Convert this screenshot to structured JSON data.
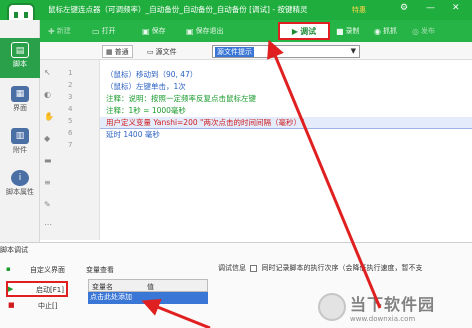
{
  "window": {
    "title": "鼠标左键连点器（可调频率）_自动备份_自动备份_自动备份 [调试] - 按键精灵",
    "vip_label": "特惠",
    "controls": [
      "⚙",
      "—",
      "✕"
    ]
  },
  "toolbar": {
    "new_label": "新建",
    "open_label": "打开",
    "save_label": "保存",
    "save_exit_label": "保存退出",
    "debug_label": "调试",
    "record_label": "录制",
    "capture_label": "抓抓",
    "publish_label": "发布"
  },
  "leftnav": {
    "items": [
      {
        "label": "脚本",
        "icon": "script-icon"
      },
      {
        "label": "界面",
        "icon": "ui-icon"
      },
      {
        "label": "附件",
        "icon": "attachment-icon"
      },
      {
        "label": "脚本属性",
        "icon": "info-icon"
      }
    ]
  },
  "tabs": {
    "normal_label": "普通",
    "source_label": "源文件",
    "dropdown_value": "源文件提示"
  },
  "editor": {
    "line_numbers": [
      "1",
      "2",
      "3",
      "4",
      "5",
      "6",
      "7"
    ],
    "lines": [
      "（鼠标）移动到（90, 47）",
      "（鼠标）左键单击，1次",
      "注释：说明：按照一定频率反复点击鼠标左键",
      "注释：1秒 = 1000毫秒",
      "用户定义变量 Yanshi=200 \"两次点击的时间间隔（毫秒）\"",
      "延时 1400 毫秒"
    ]
  },
  "debug": {
    "title": "脚本调试",
    "menu": {
      "custom_ui": "自定义界面",
      "run": "启动[F1]",
      "stop": "中止[]"
    },
    "var_title": "变量查看",
    "var_col_name": "变量名",
    "var_col_value": "值",
    "var_row": "点击此处添加",
    "info_label": "调试信息",
    "info_option": "同时记录脚本的执行次序（会降低执行速度，暂不支"
  },
  "watermark": {
    "main": "当下软件园",
    "url": "www.downxia.com"
  },
  "colors": {
    "titlebar": "#1fae3e",
    "toolbar": "#26b446",
    "highlight_box": "#e02020",
    "selection": "#3a76d6"
  }
}
